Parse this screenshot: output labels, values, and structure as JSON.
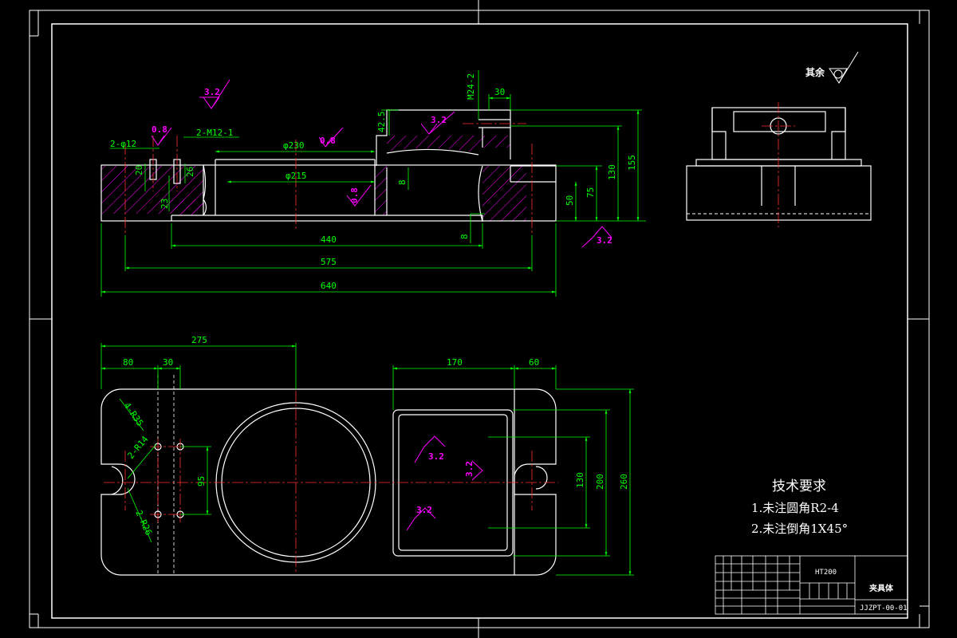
{
  "drawing": {
    "remainder_label": "其余",
    "tech_title": "技术要求",
    "tech_items": [
      "1.未注圆角R2-4",
      "2.未注倒角1X45°"
    ],
    "dims": {
      "d_2phi12": "2-φ12",
      "d_2m12": "2-M12-1",
      "d_phi230": "φ230",
      "d_phi215": "φ215",
      "d_20": "20",
      "d_26": "26",
      "d_23": "23",
      "d_8a": "8",
      "d_8b": "8",
      "d_42_5": "42.5",
      "d_m24": "M24-2",
      "d_30top": "30",
      "d_50": "50",
      "d_75": "75",
      "d_130a": "130",
      "d_155": "155",
      "d_440": "440",
      "d_575": "575",
      "d_640": "640",
      "d_275": "275",
      "d_80": "80",
      "d_30b": "30",
      "d_170": "170",
      "d_60": "60",
      "d_4r35": "4-R35",
      "d_2r14": "2-R14",
      "d_2r26": "2-R26",
      "d_95": "95",
      "d_130b": "130",
      "d_200": "200",
      "d_260": "260"
    },
    "roughness": {
      "r1": "3.2",
      "r2": "0.8",
      "r3": "0.8",
      "r4": "3.2",
      "r5": "0.8",
      "r6": "3.2",
      "r7": "3.2",
      "r8": "3.2",
      "r9": "3.2"
    }
  },
  "title_block": {
    "material": "HT200",
    "part_name": "夹具体",
    "drawing_no": "JJZPT-00-01"
  }
}
